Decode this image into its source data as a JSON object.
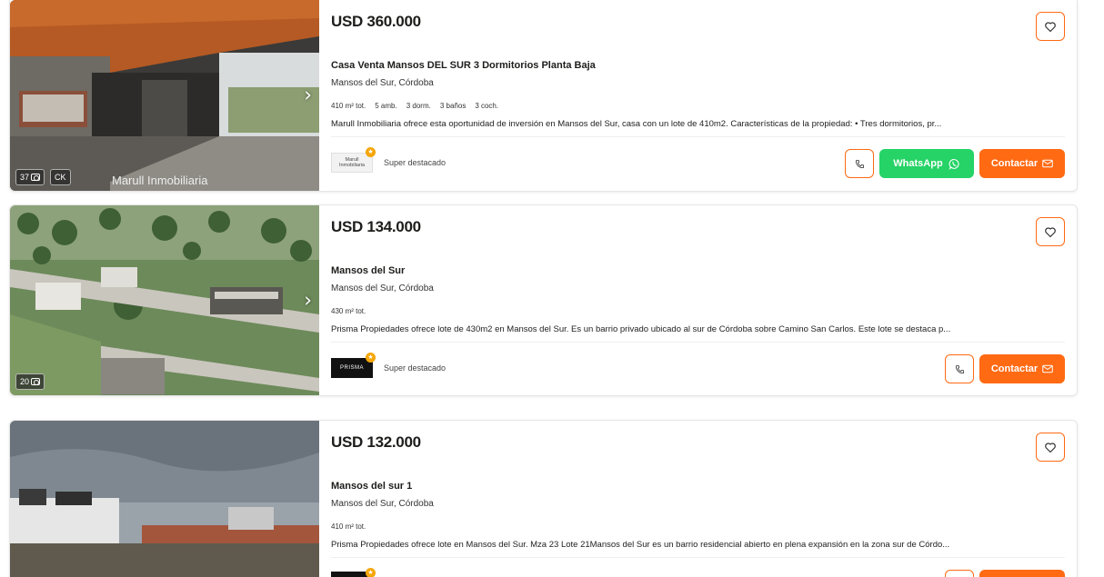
{
  "listings": [
    {
      "price": "USD 360.000",
      "title": "Casa Venta Mansos DEL SUR 3 Dormitorios Planta Baja",
      "location": "Mansos del Sur, Córdoba",
      "features": [
        "410 m² tot.",
        "5 amb.",
        "3 dorm.",
        "3 baños",
        "3 coch."
      ],
      "description": "Marull Inmobiliaria ofrece esta oportunidad de inversión en Mansos del Sur, casa con un lote de 410m2. Características de la propiedad: • Tres dormitorios, pr...",
      "photo_count": "37",
      "extra_badge": "CK",
      "watermark": "Marull Inmobiliaria",
      "publisher": "Marull Inmobiliaria",
      "highlight": "Super destacado",
      "whatsapp_label": "WhatsApp",
      "contact_label": "Contactar"
    },
    {
      "price": "USD 134.000",
      "title": "Mansos del Sur",
      "location": "Mansos del Sur, Córdoba",
      "features": [
        "430 m² tot."
      ],
      "description": "Prisma Propiedades ofrece lote de 430m2 en Mansos del Sur. Es un barrio privado ubicado al sur de Córdoba sobre Camino San Carlos. Este lote se destaca p...",
      "photo_count": "20",
      "publisher": "PRISMA",
      "highlight": "Super destacado",
      "contact_label": "Contactar"
    },
    {
      "price": "USD 132.000",
      "title": "Mansos del sur 1",
      "location": "Mansos del Sur, Córdoba",
      "features": [
        "410 m² tot."
      ],
      "description": "Prisma Propiedades ofrece lote en Mansos del Sur. Mza 23 Lote 21Mansos del Sur es un barrio residencial abierto en plena expansión en la zona sur de Córdo..."
    }
  ],
  "colors": {
    "accent": "#ff6a13",
    "whatsapp": "#25d366",
    "star": "#f6a609"
  },
  "icons": [
    "heart-icon",
    "phone-icon",
    "whatsapp-icon",
    "mail-icon",
    "camera-icon",
    "chevron-right-icon",
    "star-icon"
  ]
}
